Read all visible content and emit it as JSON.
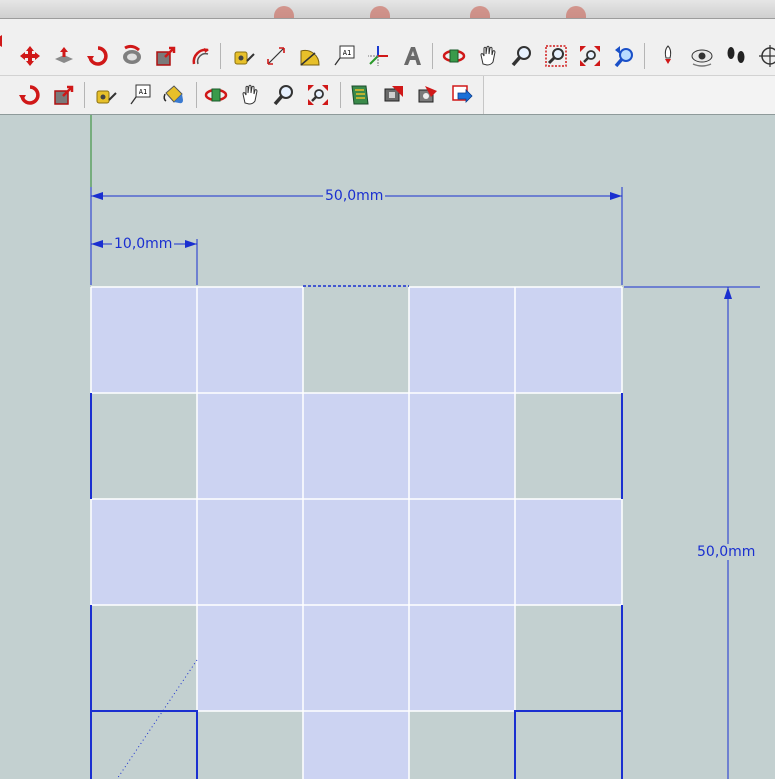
{
  "toolbar_row1": {
    "buttons": [
      {
        "icon": "move-icon",
        "name": "move-button"
      },
      {
        "icon": "push-pull-icon",
        "name": "push-pull-button"
      },
      {
        "icon": "rotate-icon",
        "name": "rotate-button"
      },
      {
        "icon": "follow-me-icon",
        "name": "follow-me-button"
      },
      {
        "icon": "scale-icon",
        "name": "scale-button"
      },
      {
        "icon": "offset-icon",
        "name": "offset-button"
      },
      {
        "icon": "tape-measure-icon",
        "name": "tape-measure-button"
      },
      {
        "icon": "dimension-icon",
        "name": "dimension-button"
      },
      {
        "icon": "protractor-icon",
        "name": "protractor-button"
      },
      {
        "icon": "text-icon",
        "name": "text-button"
      },
      {
        "icon": "axes-icon",
        "name": "axes-button"
      },
      {
        "icon": "3d-text-icon",
        "name": "3d-text-button"
      },
      {
        "icon": "orbit-icon",
        "name": "orbit-button"
      },
      {
        "icon": "pan-icon",
        "name": "pan-button"
      },
      {
        "icon": "zoom-icon",
        "name": "zoom-button"
      },
      {
        "icon": "zoom-window-icon",
        "name": "zoom-window-button"
      },
      {
        "icon": "zoom-extents-icon",
        "name": "zoom-extents-button"
      },
      {
        "icon": "previous-view-icon",
        "name": "previous-view-button"
      },
      {
        "icon": "position-camera-icon",
        "name": "position-camera-button"
      },
      {
        "icon": "look-around-icon",
        "name": "look-around-button"
      },
      {
        "icon": "walk-icon",
        "name": "walk-button"
      },
      {
        "icon": "section-plane-icon",
        "name": "section-plane-button"
      }
    ]
  },
  "toolbar_row2": {
    "buttons": [
      {
        "icon": "move-icon",
        "name": "move-button-2"
      },
      {
        "icon": "rotate-icon",
        "name": "rotate-button-2"
      },
      {
        "icon": "scale-icon",
        "name": "scale-button-2"
      },
      {
        "icon": "tape-measure-icon",
        "name": "tape-measure-button-2"
      },
      {
        "icon": "text-icon",
        "name": "text-button-2"
      },
      {
        "icon": "paint-bucket-icon",
        "name": "paint-bucket-button"
      },
      {
        "icon": "orbit-icon",
        "name": "orbit-button-2"
      },
      {
        "icon": "pan-icon",
        "name": "pan-button-2"
      },
      {
        "icon": "zoom-icon",
        "name": "zoom-button-2"
      },
      {
        "icon": "zoom-extents-icon",
        "name": "zoom-extents-button-2"
      },
      {
        "icon": "get-models-icon",
        "name": "get-models-button"
      },
      {
        "icon": "share-model-icon",
        "name": "share-model-button"
      },
      {
        "icon": "share-component-icon",
        "name": "share-component-button"
      },
      {
        "icon": "send-to-layout-icon",
        "name": "send-to-layout-button"
      }
    ]
  },
  "text_icon_label": "A1",
  "dimensions": {
    "top_overall": "50,0mm",
    "top_partial": "10,0mm",
    "right_overall": "50,0mm"
  },
  "colors": {
    "background": "#c3d0d0",
    "face_fill": "#ccd3f2",
    "edge": "#1a2fd0",
    "inner_edge": "#ffffff",
    "green_axis": "#2a8a2a"
  }
}
